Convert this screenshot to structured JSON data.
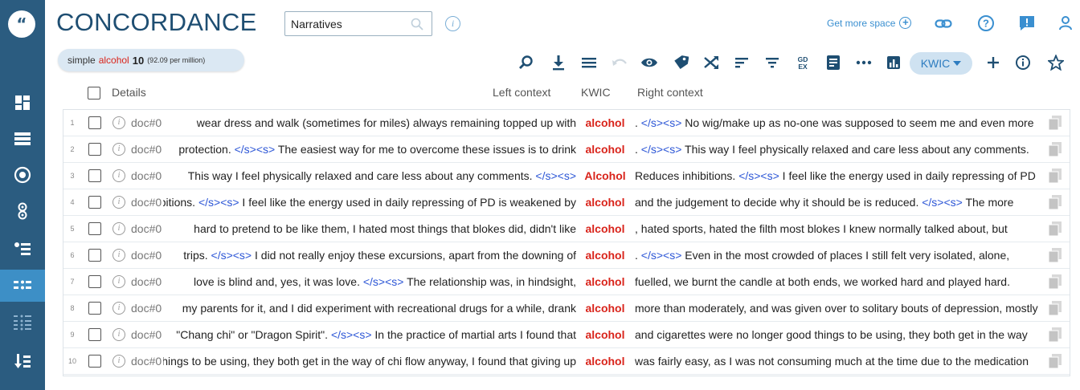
{
  "app": {
    "title": "CONCORDANCE",
    "corpus_value": "Narratives",
    "get_more_space": "Get more space"
  },
  "query": {
    "type": "simple",
    "word": "alcohol",
    "count": "10",
    "ipm": "(92.09 per million)"
  },
  "toolbar": {
    "view_mode": "KWIC",
    "icons": [
      "search-icon",
      "download-icon",
      "list-icon",
      "undo-icon",
      "eye-icon",
      "tag-icon",
      "shuffle-icon",
      "sort-icon",
      "filter-icon",
      "gdex-icon",
      "document-icon",
      "more-icon",
      "chart-icon",
      "plus-icon",
      "info-icon",
      "star-icon"
    ]
  },
  "columns": {
    "details": "Details",
    "left": "Left context",
    "kwic": "KWIC",
    "right": "Right context"
  },
  "rows": [
    {
      "num": "1",
      "doc": "doc#0",
      "left": "wear dress and walk (sometimes for miles) always remaining topped up with",
      "kwic": "alcohol",
      "right": ". </s><s> No wig/make up as no-one was supposed to seem me and even more"
    },
    {
      "num": "2",
      "doc": "doc#0",
      "left": "protection. </s><s> The easiest way for me to overcome these issues is to drink",
      "kwic": "alcohol",
      "right": ". </s><s> This way I feel physically relaxed and care less about any comments."
    },
    {
      "num": "3",
      "doc": "doc#0",
      "left": "This way I feel physically relaxed and care less about any comments. </s><s>",
      "kwic": "Alcohol",
      "right": "Reduces inhibitions. </s><s> I feel like the energy used in daily repressing of PD"
    },
    {
      "num": "4",
      "doc": "doc#0",
      "left": "inhibitions. </s><s> I feel like the energy used in daily repressing of PD is weakened by",
      "kwic": "alcohol",
      "right": "and the judgement to decide why it should be is reduced. </s><s> The more"
    },
    {
      "num": "5",
      "doc": "doc#0",
      "left": "hard to pretend to be like them, I hated most things that blokes did, didn't like",
      "kwic": "alcohol",
      "right": ", hated sports, hated the filth most blokes I knew normally talked about, but"
    },
    {
      "num": "6",
      "doc": "doc#0",
      "left": "trips. </s><s> I did not really enjoy these excursions, apart from the downing of",
      "kwic": "alcohol",
      "right": ". </s><s> Even in the most crowded of places I still felt very isolated, alone,"
    },
    {
      "num": "7",
      "doc": "doc#0",
      "left": "love is blind and, yes, it was love. </s><s> The relationship was, in hindsight,",
      "kwic": "alcohol",
      "right": "fuelled, we burnt the candle at both ends, we worked hard and played hard."
    },
    {
      "num": "8",
      "doc": "doc#0",
      "left": "my parents for it, and I did experiment with recreational drugs for a while, drank",
      "kwic": "alcohol",
      "right": "more than moderately, and was given over to solitary bouts of depression, mostly"
    },
    {
      "num": "9",
      "doc": "doc#0",
      "left": "\"Chang chi\" or \"Dragon Spirit\". </s><s> In the practice of martial arts I found that",
      "kwic": "alcohol",
      "right": "and cigarettes were no longer good things to be using, they both get in the way"
    },
    {
      "num": "10",
      "doc": "doc#0",
      "left": "good things to be using, they both get in the way of chi flow anyway, I found that giving up",
      "kwic": "alcohol",
      "right": "was fairly easy, as I was not consuming much at the time due to the medication"
    }
  ],
  "colors": {
    "sidebar": "#2b5c80",
    "sidebar_active": "#3d8fc6",
    "title": "#1e4e72",
    "keyword": "#d9241b",
    "tag": "#2c56d6",
    "link": "#3a8fd0"
  }
}
